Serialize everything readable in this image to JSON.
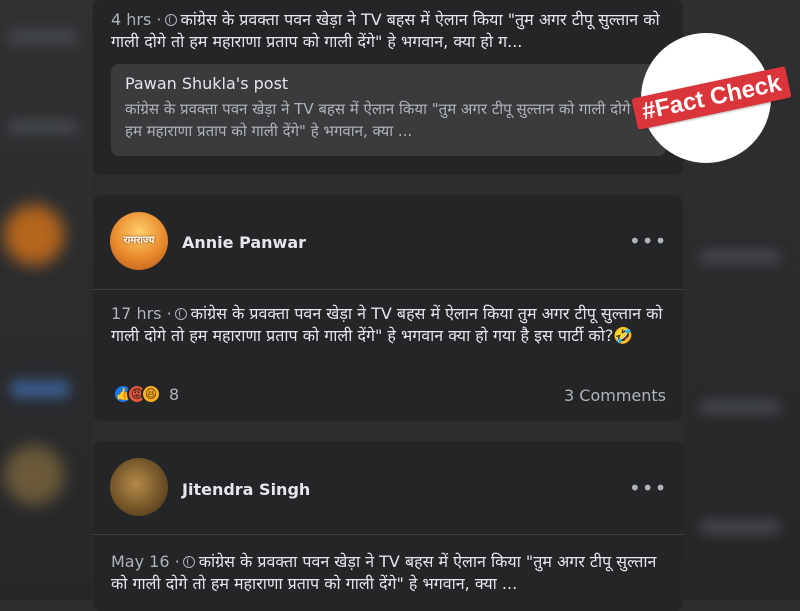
{
  "top_post": {
    "time": "4 hrs",
    "text": "कांग्रेस के प्रवक्ता पवन खेड़ा ने TV बहस में ऐलान किया \"तुम अगर टीपू सुल्तान को गाली दोगे तो हम महाराणा प्रताप को गाली देंगे\" हे भगवान, क्या हो ग...",
    "shared": {
      "title": "Pawan Shukla's post",
      "text": "कांग्रेस के प्रवक्ता पवन खेड़ा ने TV बहस में ऐलान किया \"तुम अगर टीपू सुल्तान को गाली दोगे तो हम महाराणा प्रताप को गाली देंगे\" हे भगवान, क्या ..."
    }
  },
  "post2": {
    "author": "Annie Panwar",
    "avatar_text": "रामराज्य",
    "time": "17 hrs",
    "text": "कांग्रेस के प्रवक्ता पवन खेड़ा ने TV बहस में ऐलान किया तुम अगर टीपू सुल्तान को गाली दोगे तो हम महाराणा प्रताप को गाली देंगे\" हे भगवान क्या हो गया है इस पार्टी को?🤣",
    "reaction_count": "8",
    "comments": "3 Comments",
    "more": "•••"
  },
  "post3": {
    "author": "Jitendra Singh",
    "time": "May 16",
    "text": "कांग्रेस के प्रवक्ता पवन खेड़ा ने TV बहस में ऐलान किया \"तुम अगर टीपू सुल्तान को गाली दोगे तो हम महाराणा प्रताप को गाली देंगे\" हे भगवान, क्या ...",
    "more": "•••"
  },
  "badge": {
    "label": "#Fact Check"
  },
  "colors": {
    "card": "#242526",
    "shared": "#3a3b3c",
    "text": "#e4e6eb",
    "muted": "#b0b3b8",
    "badge": "#d9353a"
  },
  "icons": [
    "globe-icon",
    "like-reaction-icon",
    "angry-reaction-icon",
    "haha-reaction-icon",
    "more-options-icon"
  ]
}
